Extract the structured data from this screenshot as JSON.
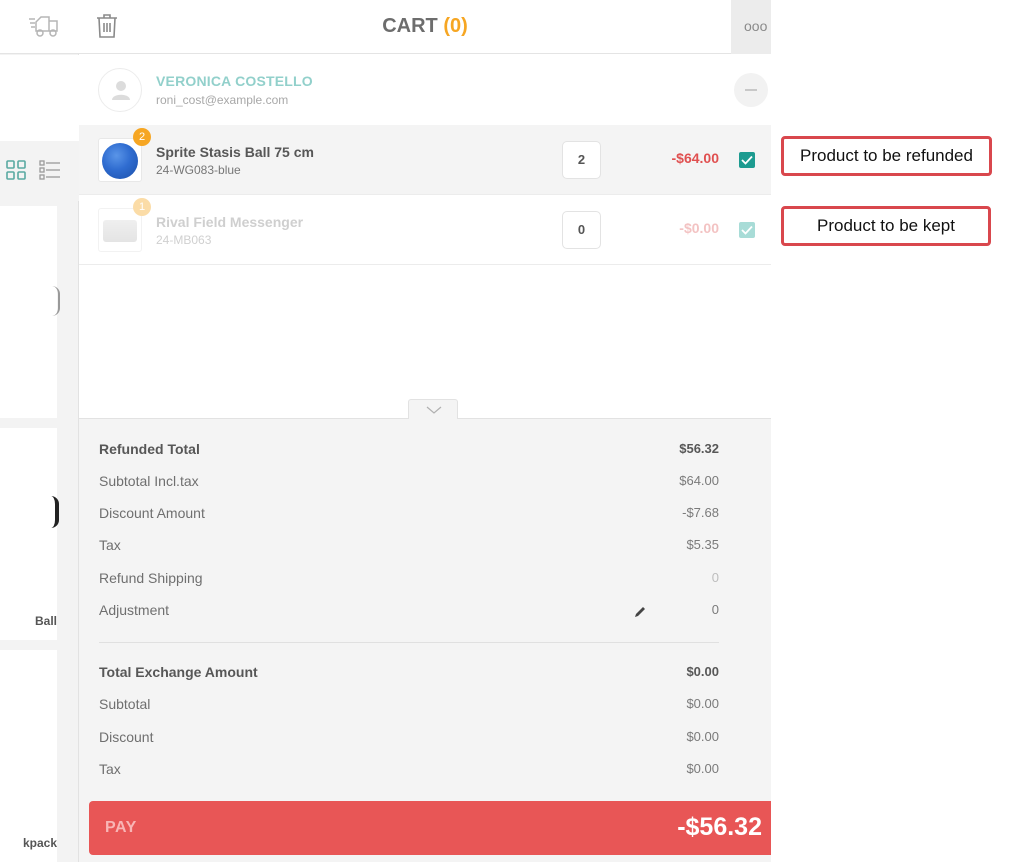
{
  "left_panel": {
    "icons": [
      "delivery-truck-icon",
      "grid-view-icon",
      "list-view-icon"
    ],
    "products": [
      {
        "name_fragment": ""
      },
      {
        "name_fragment": "Ball"
      },
      {
        "name_fragment": "kpack"
      }
    ]
  },
  "cart": {
    "title": "CART",
    "count": "(0)",
    "more_label": "ooo",
    "customer": {
      "name": "VERONICA COSTELLO",
      "email": "roni_cost@example.com"
    },
    "items": [
      {
        "name": "Sprite Stasis Ball 75 cm",
        "sku": "24-WG083-blue",
        "badge": "2",
        "qty": "2",
        "price": "-$64.00",
        "checked": true
      },
      {
        "name": "Rival Field Messenger",
        "sku": "24-MB063",
        "badge": "1",
        "qty": "0",
        "price": "-$0.00",
        "checked": true
      }
    ],
    "totals": {
      "refunded_total": {
        "label": "Refunded Total",
        "value": "$56.32"
      },
      "subtotal_incl_tax": {
        "label": "Subtotal Incl.tax",
        "value": "$64.00"
      },
      "discount_amount": {
        "label": "Discount Amount",
        "value": "-$7.68"
      },
      "tax": {
        "label": "Tax",
        "value": "$5.35"
      },
      "refund_shipping": {
        "label": "Refund Shipping",
        "value": "0"
      },
      "adjustment": {
        "label": "Adjustment",
        "value": "0"
      },
      "total_exchange": {
        "label": "Total Exchange Amount",
        "value": "$0.00"
      },
      "exchange_subtotal": {
        "label": "Subtotal",
        "value": "$0.00"
      },
      "exchange_discount": {
        "label": "Discount",
        "value": "$0.00"
      },
      "exchange_tax": {
        "label": "Tax",
        "value": "$0.00"
      }
    },
    "pay": {
      "label": "PAY",
      "amount": "-$56.32"
    }
  },
  "annotations": {
    "refunded": "Product to be refunded",
    "kept": "Product to be kept"
  },
  "colors": {
    "accent_teal": "#1d9b90",
    "accent_orange": "#f6a623",
    "pay_red": "#e85656",
    "price_red": "#e05050",
    "annotation_border": "#d9474d"
  }
}
